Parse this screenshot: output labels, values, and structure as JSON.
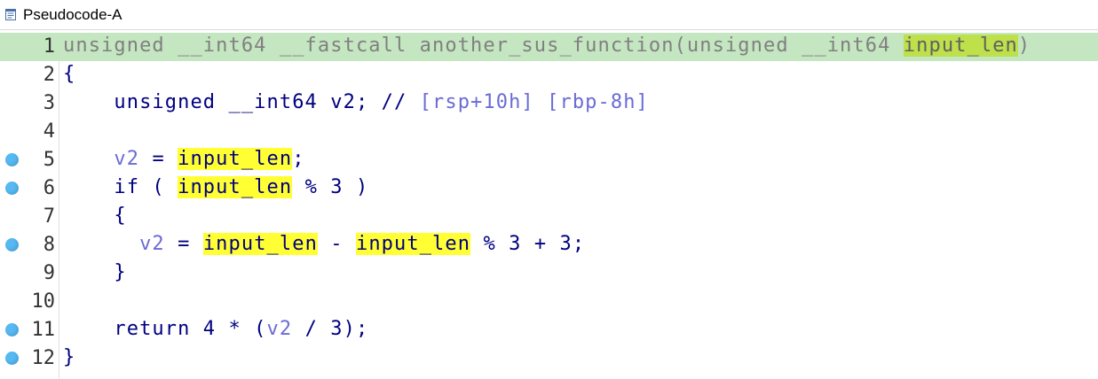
{
  "tab": {
    "title": "Pseudocode-A",
    "icon": "pseudocode-doc-icon"
  },
  "colors": {
    "header_bg": "#c4e6c0",
    "highlight": "#ffff33",
    "breakpoint": "#56b9f2",
    "keyword": "#000080",
    "variable": "#6b6bd6"
  },
  "lines": [
    {
      "num": "1",
      "breakpoint": false,
      "header": true,
      "tokens": [
        {
          "t": "unsigned __int64 __fastcall another_sus_function(unsigned __int64 ",
          "c": "grey"
        },
        {
          "t": "input_len",
          "c": "hl-header"
        },
        {
          "t": ")",
          "c": "grey"
        }
      ]
    },
    {
      "num": "2",
      "breakpoint": false,
      "tokens": [
        {
          "t": "{",
          "c": "kw"
        }
      ]
    },
    {
      "num": "3",
      "breakpoint": false,
      "tokens": [
        {
          "t": "    unsigned __int64 v2; // ",
          "c": "kw"
        },
        {
          "t": "[rsp+10h] [rbp-8h]",
          "c": "var"
        }
      ]
    },
    {
      "num": "4",
      "breakpoint": false,
      "tokens": []
    },
    {
      "num": "5",
      "breakpoint": true,
      "tokens": [
        {
          "t": "    ",
          "c": "kw"
        },
        {
          "t": "v2",
          "c": "var"
        },
        {
          "t": " = ",
          "c": "kw"
        },
        {
          "t": "input_len",
          "c": "hl"
        },
        {
          "t": ";",
          "c": "kw"
        }
      ]
    },
    {
      "num": "6",
      "breakpoint": true,
      "tokens": [
        {
          "t": "    if ( ",
          "c": "kw"
        },
        {
          "t": "input_len",
          "c": "hl"
        },
        {
          "t": " % 3 )",
          "c": "kw"
        }
      ]
    },
    {
      "num": "7",
      "breakpoint": false,
      "tokens": [
        {
          "t": "    {",
          "c": "kw"
        }
      ]
    },
    {
      "num": "8",
      "breakpoint": true,
      "tokens": [
        {
          "t": "      ",
          "c": "kw"
        },
        {
          "t": "v2",
          "c": "var"
        },
        {
          "t": " = ",
          "c": "kw"
        },
        {
          "t": "input_len",
          "c": "hl"
        },
        {
          "t": " - ",
          "c": "kw"
        },
        {
          "t": "input_len",
          "c": "hl"
        },
        {
          "t": " % 3 + 3;",
          "c": "kw"
        }
      ]
    },
    {
      "num": "9",
      "breakpoint": false,
      "tokens": [
        {
          "t": "    }",
          "c": "kw"
        }
      ]
    },
    {
      "num": "10",
      "breakpoint": false,
      "tokens": []
    },
    {
      "num": "11",
      "breakpoint": true,
      "tokens": [
        {
          "t": "    return 4 * (",
          "c": "kw"
        },
        {
          "t": "v2",
          "c": "var"
        },
        {
          "t": " / 3);",
          "c": "kw"
        }
      ]
    },
    {
      "num": "12",
      "breakpoint": true,
      "tokens": [
        {
          "t": "}",
          "c": "kw"
        }
      ]
    }
  ]
}
